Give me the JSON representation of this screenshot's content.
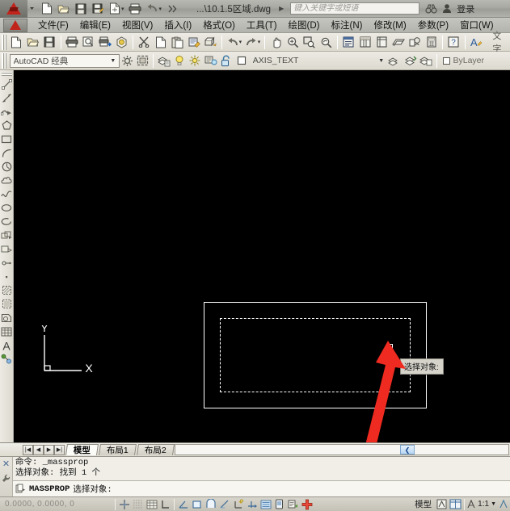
{
  "titlebar": {
    "document_title": "...\\10.1.5区域.dwg",
    "search_placeholder": "键入关键字或短语",
    "login_label": "登录",
    "quick_access": [
      {
        "name": "new-file",
        "label": "新建"
      },
      {
        "name": "open-file",
        "label": "打开"
      },
      {
        "name": "save-file",
        "label": "保存"
      },
      {
        "name": "save-as",
        "label": "另存为"
      },
      {
        "name": "export",
        "label": "输出"
      },
      {
        "name": "plot",
        "label": "打印"
      },
      {
        "name": "undo",
        "label": "放弃"
      },
      {
        "name": "more",
        "label": "更多"
      }
    ],
    "icons": [
      "binoculars-icon",
      "user-icon"
    ]
  },
  "menubar": {
    "items": [
      {
        "label": "文件(F)"
      },
      {
        "label": "编辑(E)"
      },
      {
        "label": "视图(V)"
      },
      {
        "label": "插入(I)"
      },
      {
        "label": "格式(O)"
      },
      {
        "label": "工具(T)"
      },
      {
        "label": "绘图(D)"
      },
      {
        "label": "标注(N)"
      },
      {
        "label": "修改(M)"
      },
      {
        "label": "参数(P)"
      },
      {
        "label": "窗口(W)"
      }
    ]
  },
  "toolbar_row1": {
    "text_label": "文字"
  },
  "toolbar_row3": {
    "workspace": "AutoCAD 经典",
    "layer_name": "AXIS_TEXT",
    "color_value": "ByLayer"
  },
  "canvas": {
    "ucs_x_label": "X",
    "ucs_y_label": "Y",
    "tooltip": "选择对象:",
    "objects": [
      {
        "name": "outer-rectangle",
        "style": "solid",
        "color": "#ffffff"
      },
      {
        "name": "inner-rectangle",
        "style": "dashed-selected",
        "color": "#ffffff"
      }
    ],
    "annotation": {
      "name": "red-arrow",
      "color": "#e8241c"
    }
  },
  "tabs": {
    "items": [
      {
        "label": "模型",
        "active": true
      },
      {
        "label": "布局1",
        "active": false
      },
      {
        "label": "布局2",
        "active": false
      }
    ]
  },
  "command": {
    "history": [
      "命令: _massprop",
      "选择对象: 找到 1 个"
    ],
    "prompt_command": "MASSPROP",
    "prompt_text": "选择对象:"
  },
  "status": {
    "coordinates": "0.0000, 0.0000, 0",
    "model_label": "模型",
    "scale": "1:1",
    "toggles": [
      {
        "name": "snap-toggle",
        "label": "捕捉"
      },
      {
        "name": "grid-toggle",
        "label": "栅格"
      },
      {
        "name": "ortho-toggle",
        "label": "正交"
      },
      {
        "name": "polar-toggle",
        "label": "极轴"
      },
      {
        "name": "osnap-toggle",
        "label": "对象捕捉"
      },
      {
        "name": "otrack-toggle",
        "label": "对象追踪"
      },
      {
        "name": "ducs-toggle",
        "label": "DUCS"
      },
      {
        "name": "dyn-toggle",
        "label": "DYN"
      },
      {
        "name": "lineweight-toggle",
        "label": "线宽"
      },
      {
        "name": "transparency-toggle",
        "label": "透明度"
      },
      {
        "name": "quickprops-toggle",
        "label": "快捷特性"
      },
      {
        "name": "selectioncycling-toggle",
        "label": "选择循环"
      }
    ]
  }
}
